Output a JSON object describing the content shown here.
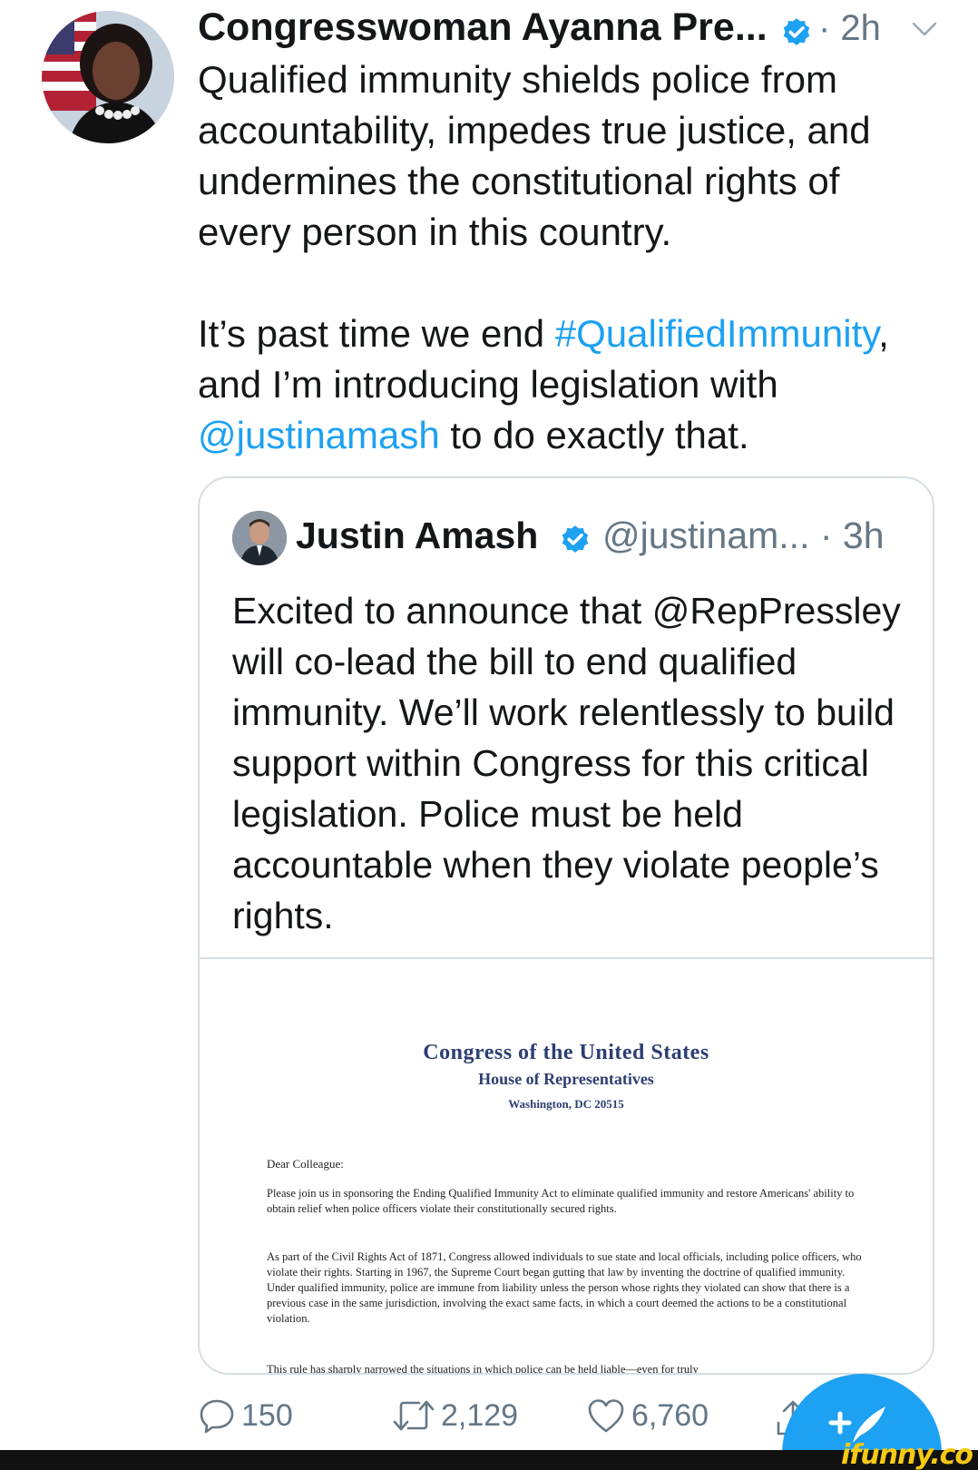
{
  "author": {
    "name": "Congresswoman Ayanna Pre...",
    "dot_time": "· 2h"
  },
  "tweet": {
    "line1": "Qualified immunity shields police from accountability, impedes true justice, and undermines the constitutional rights of every person in this country.",
    "p2_pre": "It’s past time we end ",
    "hashtag": "#QualifiedImmunity",
    "p2_mid": ", and I’m introducing legislation with ",
    "mention": "@justinamash",
    "p2_post": " to do exactly that."
  },
  "quoted": {
    "name": "Justin Amash",
    "handle_time": "@justinam... · 3h",
    "text": "Excited to announce that @RepPressley will co-lead the bill to end qualified immunity. We’ll work relentlessly to build support within Congress for this critical legislation. Police must be held accountable when they violate people’s rights.",
    "letter": {
      "heading": "Congress of the United States",
      "subheading": "House of Representatives",
      "location": "Washington, DC 20515",
      "greeting": "Dear Colleague:",
      "para1": "Please join us in sponsoring the Ending Qualified Immunity Act to eliminate qualified immunity and restore Americans' ability to obtain relief when police officers violate their constitutionally secured rights.",
      "para2": "As part of the Civil Rights Act of 1871, Congress allowed individuals to sue state and local officials, including police officers, who violate their rights. Starting in 1967, the Supreme Court began gutting that law by inventing the doctrine of qualified immunity. Under qualified immunity, police are immune from liability unless the person whose rights they violated can show that there is a previous case in the same jurisdiction, involving the exact same facts, in which a court deemed the actions to be a constitutional violation.",
      "para3": "This rule has sharply narrowed the situations in which police can be held liable—even for truly"
    }
  },
  "actions": {
    "replies": "150",
    "retweets": "2,129",
    "likes": "6,760"
  },
  "watermark": "ifunny.co",
  "colors": {
    "link": "#1da1f2",
    "verified": "#1da1f2",
    "muted": "#657786",
    "fab": "#1da1f2"
  },
  "icons": [
    "verified-badge-icon",
    "chevron-down-icon",
    "reply-icon",
    "retweet-icon",
    "like-icon",
    "share-icon",
    "compose-tweet-icon"
  ]
}
